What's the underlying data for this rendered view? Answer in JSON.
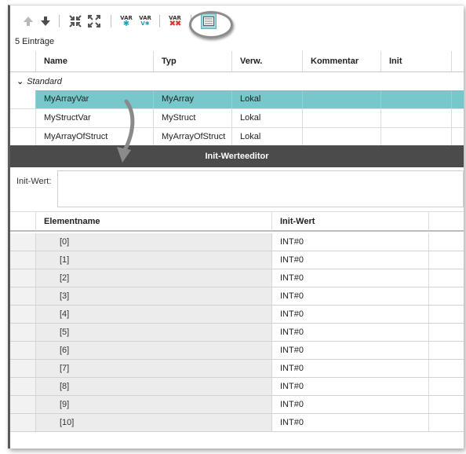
{
  "toolbar": {
    "buttons": [
      {
        "name": "move-up-icon"
      },
      {
        "name": "move-down-icon"
      },
      {
        "name": "collapse-all-icon"
      },
      {
        "name": "expand-all-icon"
      },
      {
        "name": "add-variable-icon",
        "label": "VAR"
      },
      {
        "name": "insert-variable-icon",
        "label": "VAR"
      },
      {
        "name": "delete-variable-icon",
        "label": "VAR"
      },
      {
        "name": "init-value-editor-icon"
      }
    ]
  },
  "entry_count": "5 Einträge",
  "variables_table": {
    "columns": [
      "Name",
      "Typ",
      "Verw.",
      "Kommentar",
      "Init"
    ],
    "group": "Standard",
    "rows": [
      {
        "name": "MyArrayVar",
        "type": "MyArray",
        "usage": "Lokal",
        "comment": "",
        "init": "",
        "selected": true
      },
      {
        "name": "MyStructVar",
        "type": "MyStruct",
        "usage": "Lokal",
        "comment": "",
        "init": "",
        "selected": false
      },
      {
        "name": "MyArrayOfStruct",
        "type": "MyArrayOfStruct",
        "usage": "Lokal",
        "comment": "",
        "init": "",
        "selected": false
      }
    ]
  },
  "init_editor": {
    "title": "Init-Werteeditor",
    "init_label": "Init-Wert:",
    "init_value": "",
    "columns": [
      "Elementname",
      "Init-Wert"
    ],
    "rows": [
      {
        "element": "[0]",
        "value": "INT#0"
      },
      {
        "element": "[1]",
        "value": "INT#0"
      },
      {
        "element": "[2]",
        "value": "INT#0"
      },
      {
        "element": "[3]",
        "value": "INT#0"
      },
      {
        "element": "[4]",
        "value": "INT#0"
      },
      {
        "element": "[5]",
        "value": "INT#0"
      },
      {
        "element": "[6]",
        "value": "INT#0"
      },
      {
        "element": "[7]",
        "value": "INT#0"
      },
      {
        "element": "[8]",
        "value": "INT#0"
      },
      {
        "element": "[9]",
        "value": "INT#0"
      },
      {
        "element": "[10]",
        "value": "INT#0"
      }
    ]
  },
  "colors": {
    "selection": "#77c8cb",
    "panel_header": "#4b4b4b",
    "delete_icon_red": "#d9332b",
    "add_icon_teal": "#1aa3b5"
  }
}
